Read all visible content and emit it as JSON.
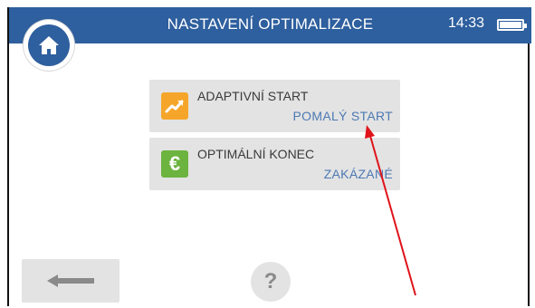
{
  "header": {
    "title": "NASTAVENÍ OPTIMALIZACE",
    "time": "14:33",
    "bar_color": "#2e5f9e"
  },
  "home": {
    "icon": "home-icon"
  },
  "settings": [
    {
      "label": "ADAPTIVNÍ START",
      "value": "POMALÝ START",
      "icon": "trend-up-icon",
      "icon_color": "#f5a62a"
    },
    {
      "label": "OPTIMÁLNÍ KONEC",
      "value": "ZAKÁZANÉ",
      "icon": "euro-icon",
      "icon_color": "#6cb33f",
      "icon_glyph": "€"
    }
  ],
  "footer": {
    "back_icon": "arrow-left-icon",
    "help_glyph": "?"
  },
  "colors": {
    "value_text": "#4d79b3",
    "tile_bg": "#e3e3e3",
    "annotation_arrow": "#e0131b"
  }
}
